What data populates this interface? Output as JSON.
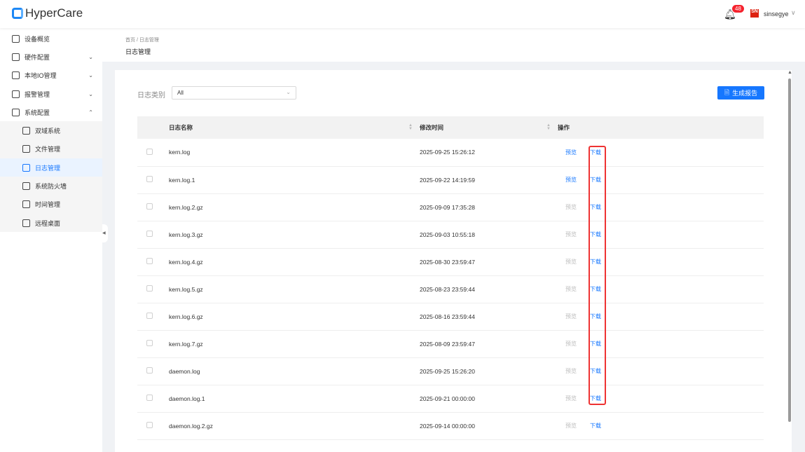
{
  "app": {
    "name": "HyperCare",
    "notifications": "48",
    "user": "sinsegye",
    "user_logo": "SN"
  },
  "sidebar": {
    "items": [
      {
        "label": "设备概览",
        "chev": ""
      },
      {
        "label": "硬件配置",
        "chev": "⌄"
      },
      {
        "label": "本地IO管理",
        "chev": "⌄"
      },
      {
        "label": "报警管理",
        "chev": "⌄"
      },
      {
        "label": "系统配置",
        "chev": "⌃"
      }
    ],
    "sub": [
      "双域系统",
      "文件管理",
      "日志管理",
      "系统防火墙",
      "时间管理",
      "远程桌面"
    ]
  },
  "breadcrumb": {
    "home": "首页",
    "sep": "/",
    "current": "日志管理"
  },
  "page_title": "日志管理",
  "filter": {
    "label": "日志类别",
    "value": "All"
  },
  "generate_button": "生成报告",
  "table": {
    "headers": [
      "日志名称",
      "修改时间",
      "操作"
    ],
    "preview": "预览",
    "download": "下载",
    "rows": [
      {
        "name": "kern.log",
        "time": "2025-09-25 15:26:12",
        "preview_enabled": true
      },
      {
        "name": "kern.log.1",
        "time": "2025-09-22 14:19:59",
        "preview_enabled": true
      },
      {
        "name": "kern.log.2.gz",
        "time": "2025-09-09 17:35:28",
        "preview_enabled": false
      },
      {
        "name": "kern.log.3.gz",
        "time": "2025-09-03 10:55:18",
        "preview_enabled": false
      },
      {
        "name": "kern.log.4.gz",
        "time": "2025-08-30 23:59:47",
        "preview_enabled": false
      },
      {
        "name": "kern.log.5.gz",
        "time": "2025-08-23 23:59:44",
        "preview_enabled": false
      },
      {
        "name": "kern.log.6.gz",
        "time": "2025-08-16 23:59:44",
        "preview_enabled": false
      },
      {
        "name": "kern.log.7.gz",
        "time": "2025-08-09 23:59:47",
        "preview_enabled": false
      },
      {
        "name": "daemon.log",
        "time": "2025-09-25 15:26:20",
        "preview_enabled": false
      },
      {
        "name": "daemon.log.1",
        "time": "2025-09-21 00:00:00",
        "preview_enabled": false
      },
      {
        "name": "daemon.log.2.gz",
        "time": "2025-09-14 00:00:00",
        "preview_enabled": false
      }
    ]
  }
}
